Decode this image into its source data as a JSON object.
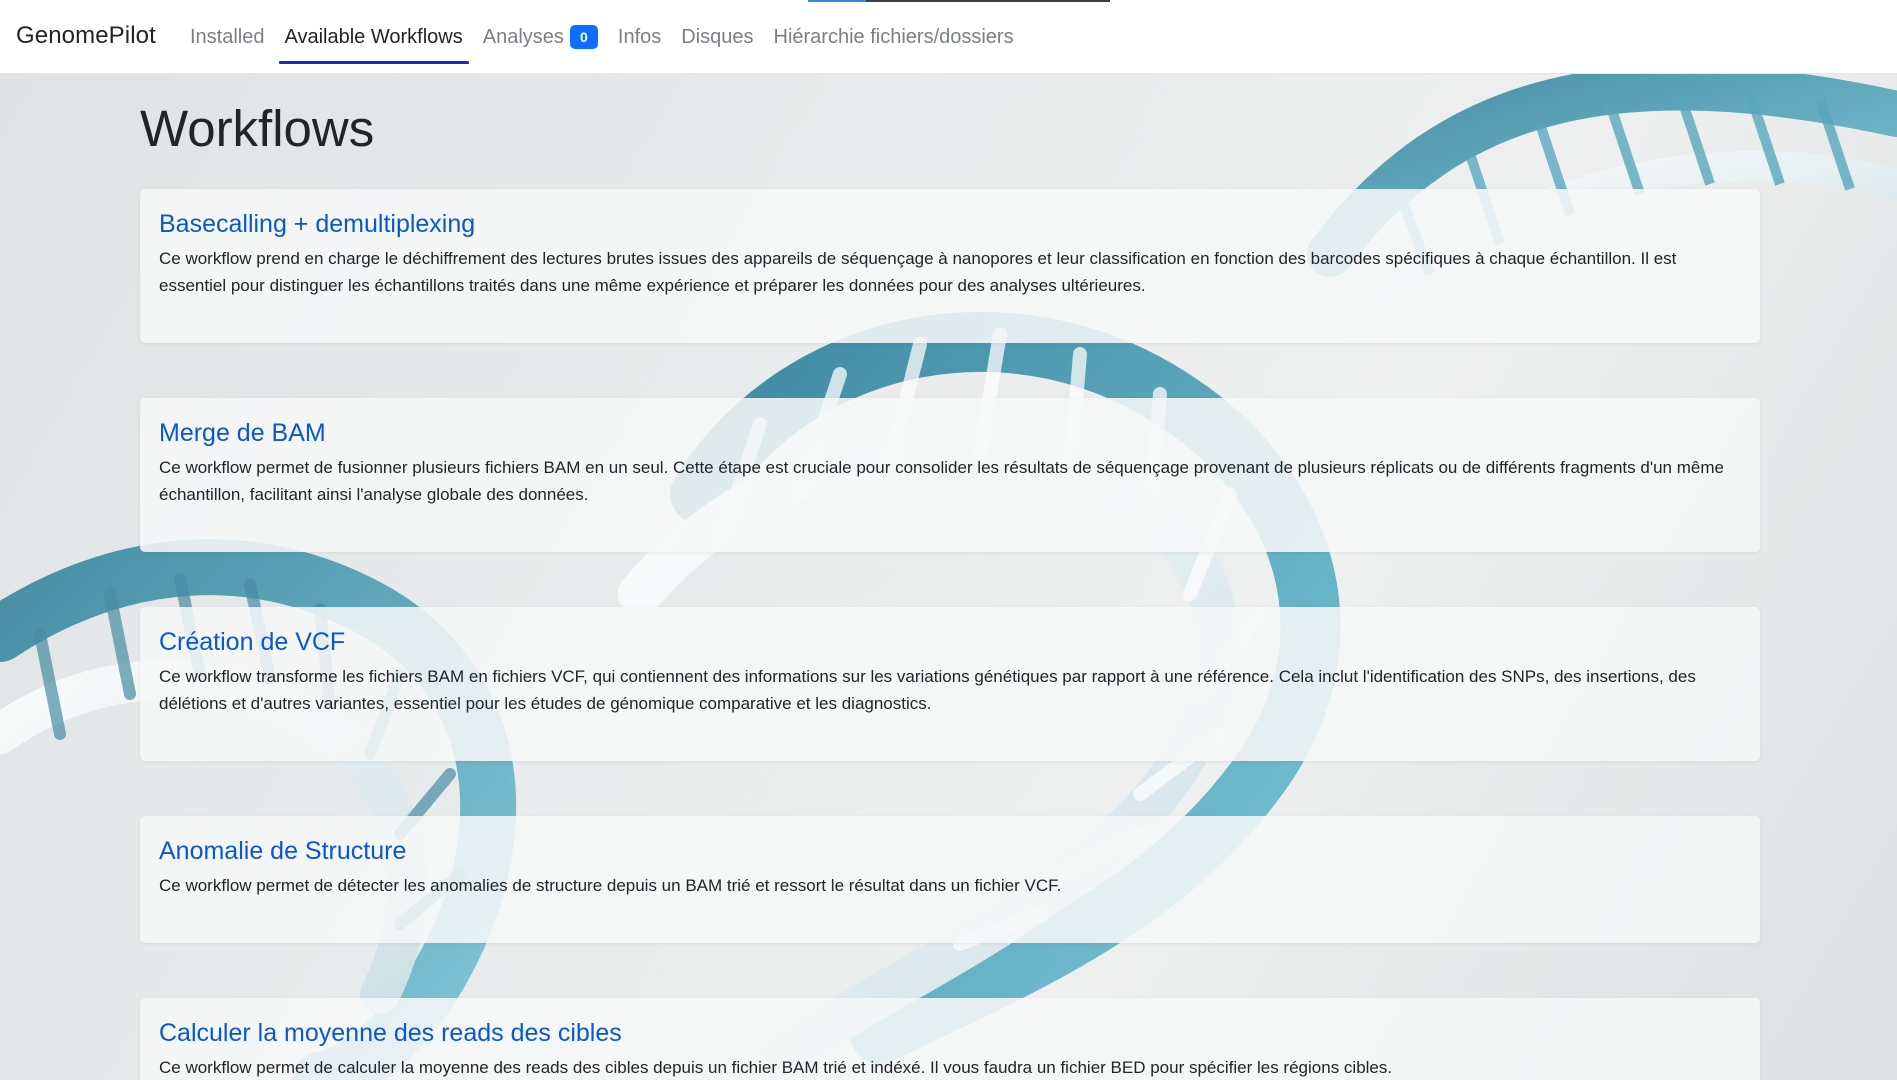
{
  "navbar": {
    "brand": "GenomePilot",
    "links": [
      {
        "label": "Installed"
      },
      {
        "label": "Available Workflows"
      },
      {
        "label": "Analyses",
        "badge": "0"
      },
      {
        "label": "Infos"
      },
      {
        "label": "Disques"
      },
      {
        "label": "Hiérarchie fichiers/dossiers"
      }
    ],
    "active_link": "Available Workflows"
  },
  "page": {
    "title": "Workflows"
  },
  "workflows": [
    {
      "title": "Basecalling + demultiplexing",
      "description": "Ce workflow prend en charge le déchiffrement des lectures brutes issues des appareils de séquençage à nanopores et leur classification en fonction des barcodes spécifiques à chaque échantillon. Il est essentiel pour distinguer les échantillons traités dans une même expérience et préparer les données pour des analyses ultérieures."
    },
    {
      "title": "Merge de BAM",
      "description": "Ce workflow permet de fusionner plusieurs fichiers BAM en un seul. Cette étape est cruciale pour consolider les résultats de séquençage provenant de plusieurs réplicats ou de différents fragments d'un même échantillon, facilitant ainsi l'analyse globale des données."
    },
    {
      "title": "Création de VCF",
      "description": "Ce workflow transforme les fichiers BAM en fichiers VCF, qui contiennent des informations sur les variations génétiques par rapport à une référence. Cela inclut l'identification des SNPs, des insertions, des délétions et d'autres variantes, essentiel pour les études de génomique comparative et les diagnostics."
    },
    {
      "title": "Anomalie de Structure",
      "description": "Ce workflow permet de détecter les anomalies de structure depuis un BAM trié et ressort le résultat dans un fichier VCF."
    },
    {
      "title": "Calculer la moyenne des reads des cibles",
      "description": "Ce workflow permet de calculer la moyenne des reads des cibles depuis un fichier BAM trié et indéxé. Il vous faudra un fichier BED pour spécifier les régions cibles."
    }
  ],
  "colors": {
    "accent": "#0d6efd",
    "link_title": "#0a58ca",
    "active_underline": "#1f24c8",
    "dna_teal": "#3f9bb3"
  },
  "icons": {
    "background": "dna-helix-illustration"
  }
}
